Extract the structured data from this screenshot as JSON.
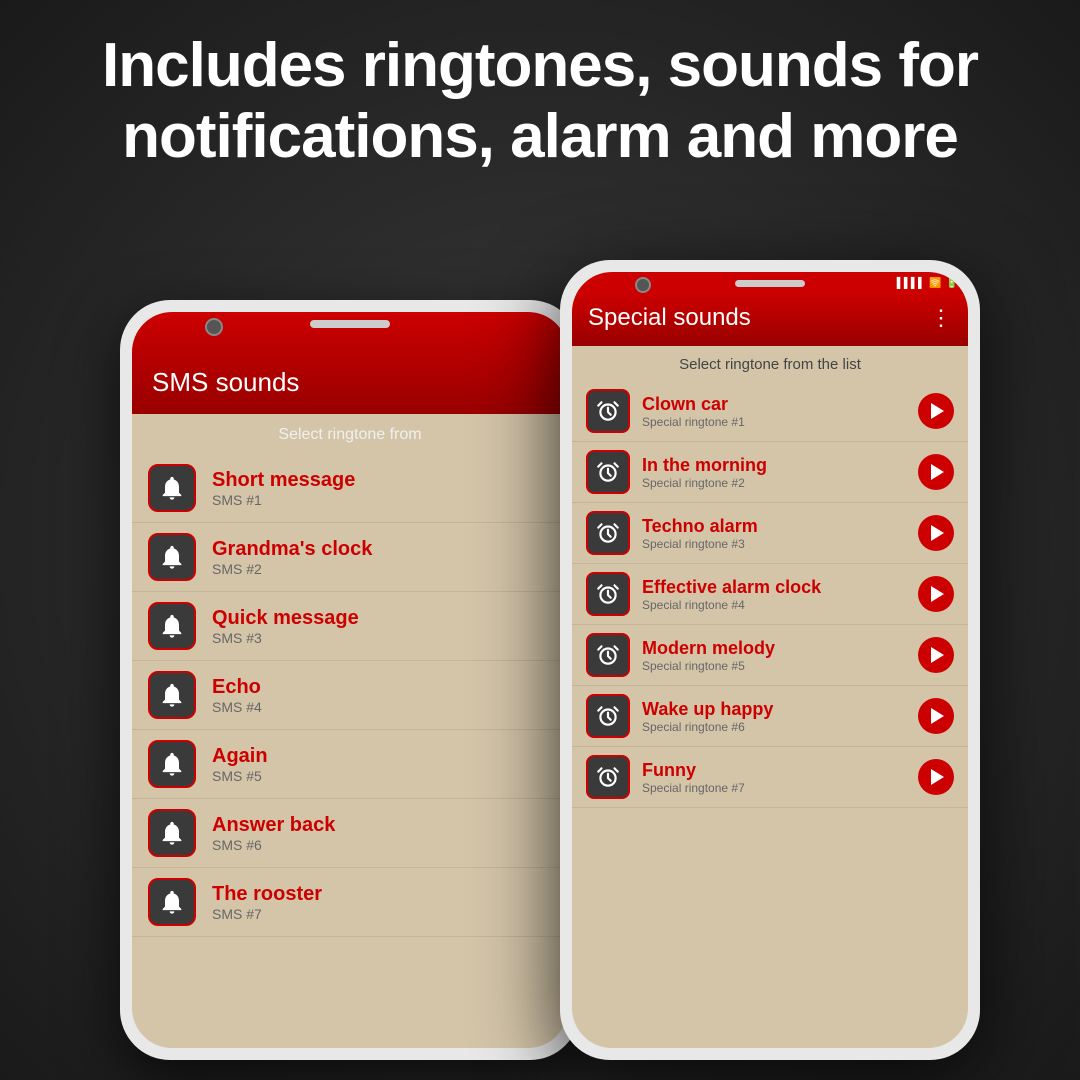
{
  "headline": {
    "line1": "Includes ringtones, sounds for",
    "line2": "notifications, alarm and more"
  },
  "phone1": {
    "title": "SMS sounds",
    "subtitle": "Select ringtone from",
    "items": [
      {
        "name": "Short message",
        "sub": "SMS #1"
      },
      {
        "name": "Grandma's clock",
        "sub": "SMS #2"
      },
      {
        "name": "Quick message",
        "sub": "SMS #3"
      },
      {
        "name": "Echo",
        "sub": "SMS #4"
      },
      {
        "name": "Again",
        "sub": "SMS #5"
      },
      {
        "name": "Answer back",
        "sub": "SMS #6"
      },
      {
        "name": "The rooster",
        "sub": "SMS #7"
      }
    ]
  },
  "phone2": {
    "title": "Special sounds",
    "subtitle": "Select ringtone from the list",
    "items": [
      {
        "name": "Clown car",
        "sub": "Special ringtone #1"
      },
      {
        "name": "In the morning",
        "sub": "Special ringtone #2"
      },
      {
        "name": "Techno alarm",
        "sub": "Special ringtone #3"
      },
      {
        "name": "Effective alarm clock",
        "sub": "Special ringtone #4"
      },
      {
        "name": "Modern melody",
        "sub": "Special ringtone #5"
      },
      {
        "name": "Wake up happy",
        "sub": "Special ringtone #6"
      },
      {
        "name": "Funny",
        "sub": "Special ringtone #7"
      }
    ]
  }
}
